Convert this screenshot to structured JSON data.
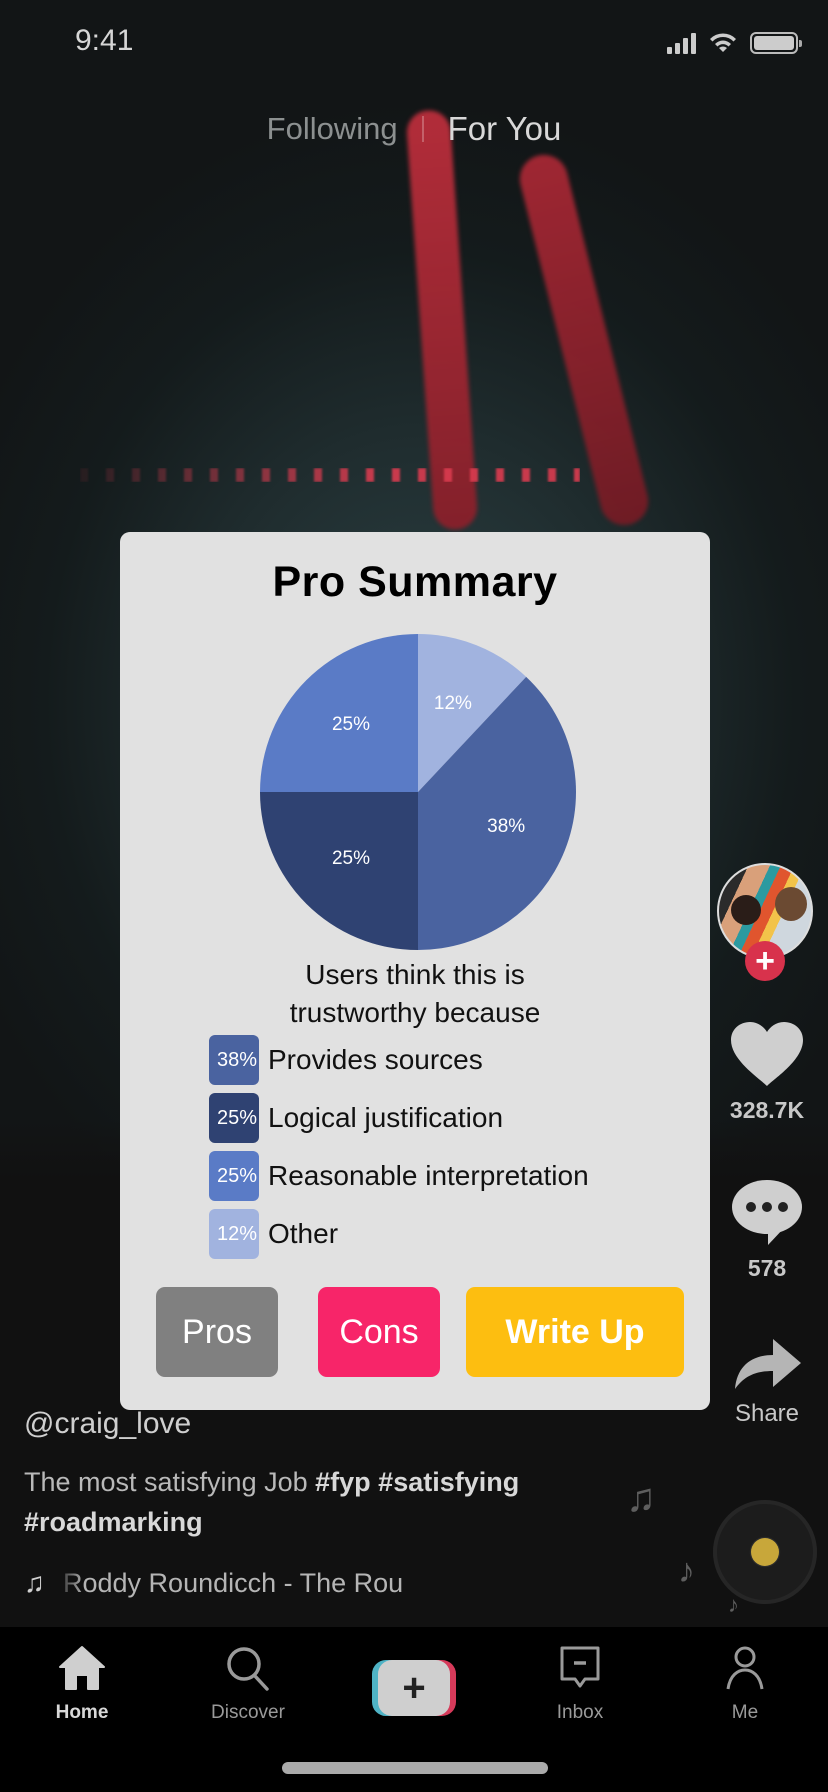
{
  "status_bar": {
    "time": "9:41",
    "icons": [
      "signal-icon",
      "wifi-icon",
      "battery-icon"
    ]
  },
  "top_tabs": {
    "following": "Following",
    "for_you": "For You",
    "active": "For You"
  },
  "actions": {
    "avatar_follow_icon": "plus-icon",
    "like_count": "328.7K",
    "comment_count": "578",
    "share_label": "Share"
  },
  "post": {
    "username": "@craig_love",
    "caption_text": "The most satisfying Job ",
    "hashtags": [
      "#fyp",
      "#satisfying",
      "#roadmarking"
    ],
    "music_title": "Roddy Roundicch - The Rou"
  },
  "bottom_nav": {
    "items": [
      {
        "label": "Home",
        "icon": "home-icon",
        "active": true
      },
      {
        "label": "Discover",
        "icon": "search-icon",
        "active": false
      },
      {
        "label": "",
        "icon": "plus-icon",
        "active": false
      },
      {
        "label": "Inbox",
        "icon": "inbox-icon",
        "active": false
      },
      {
        "label": "Me",
        "icon": "profile-icon",
        "active": false
      }
    ]
  },
  "modal": {
    "title": "Pro Summary",
    "subtitle_line1": "Users think this is",
    "subtitle_line2": "trustworthy because",
    "buttons": {
      "pros": "Pros",
      "cons": "Cons",
      "write_up": "Write Up"
    },
    "colors": {
      "pros_button": "#808080",
      "cons_button": "#F72569",
      "write_up_button": "#FDBE10"
    }
  },
  "chart_data": {
    "type": "pie",
    "title": "Pro Summary",
    "subtitle": "Users think this is trustworthy because",
    "start_angle_deg": 0,
    "direction": "clockwise",
    "slices": [
      {
        "label": "Other",
        "value": 12,
        "display": "12%",
        "color": "#A1B3DF"
      },
      {
        "label": "Provides sources",
        "value": 38,
        "display": "38%",
        "color": "#4A63A0"
      },
      {
        "label": "Logical justification",
        "value": 25,
        "display": "25%",
        "color": "#2F4272"
      },
      {
        "label": "Reasonable interpretation",
        "value": 25,
        "display": "25%",
        "color": "#5A7BC6"
      }
    ],
    "legend": [
      {
        "label": "Provides sources",
        "display": "38%",
        "color": "#4A63A0"
      },
      {
        "label": "Logical justification",
        "display": "25%",
        "color": "#2F4272"
      },
      {
        "label": "Reasonable interpretation",
        "display": "25%",
        "color": "#5A7BC6"
      },
      {
        "label": "Other",
        "display": "12%",
        "color": "#A1B3DF"
      }
    ],
    "legend_placement": "bottom"
  }
}
